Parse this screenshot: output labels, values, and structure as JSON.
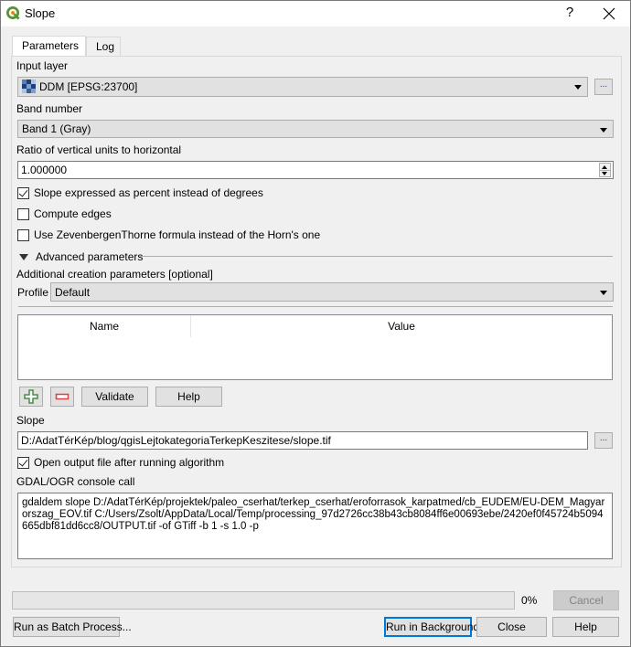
{
  "window": {
    "title": "Slope",
    "help_label": "?",
    "icons": {
      "app": "qgis-logo-icon",
      "close": "close-icon"
    }
  },
  "tabs": [
    {
      "label": "Parameters",
      "active": true
    },
    {
      "label": "Log",
      "active": false
    }
  ],
  "params": {
    "input_layer": {
      "label": "Input layer",
      "value": "DDM [EPSG:23700]",
      "icon": "raster-layer-icon",
      "browse_label": "..."
    },
    "band_number": {
      "label": "Band number",
      "value": "Band 1 (Gray)"
    },
    "ratio": {
      "label": "Ratio of vertical units to horizontal",
      "value": "1.000000"
    },
    "checkboxes": [
      {
        "label": "Slope expressed as percent instead of degrees",
        "checked": true
      },
      {
        "label": "Compute edges",
        "checked": false
      },
      {
        "label": "Use ZevenbergenThorne formula instead of the Horn's one",
        "checked": false
      }
    ],
    "advanced": {
      "label": "Advanced parameters",
      "expanded": true,
      "creation_label": "Additional creation parameters [optional]",
      "profile_label": "Profile",
      "profile_value": "Default",
      "table_headers": [
        "Name",
        "Value"
      ],
      "table_rows": [],
      "add_icon": "plus-icon",
      "remove_icon": "minus-icon",
      "validate_label": "Validate",
      "help_label": "Help"
    },
    "output": {
      "label": "Slope",
      "value": "D:/AdatTérKép/blog/qgisLejtokategoriaTerkepKeszitese/slope.tif",
      "browse_label": "...",
      "open_after_label": "Open output file after running algorithm",
      "open_after_checked": true
    },
    "console": {
      "label": "GDAL/OGR console call",
      "value": "gdaldem slope D:/AdatTérKép/projektek/paleo_cserhat/terkep_cserhat/eroforrasok_karpatmed/cb_EUDEM/EU-DEM_Magyarorszag_EOV.tif C:/Users/Zsolt/AppData/Local/Temp/processing_97d2726cc38b43cb8084ff6e00693ebe/2420ef0f45724b5094665dbf81dd6cc8/OUTPUT.tif -of GTiff -b 1 -s 1.0 -p"
    }
  },
  "footer": {
    "progress_percent": 0,
    "progress_text": "0%",
    "cancel_label": "Cancel",
    "batch_label": "Run as Batch Process...",
    "run_bg_label": "Run in Background",
    "close_label": "Close",
    "help_label": "Help"
  },
  "colors": {
    "accent": "#0078d7",
    "add_green": "#4a8a4a",
    "remove_red": "#e04040"
  }
}
